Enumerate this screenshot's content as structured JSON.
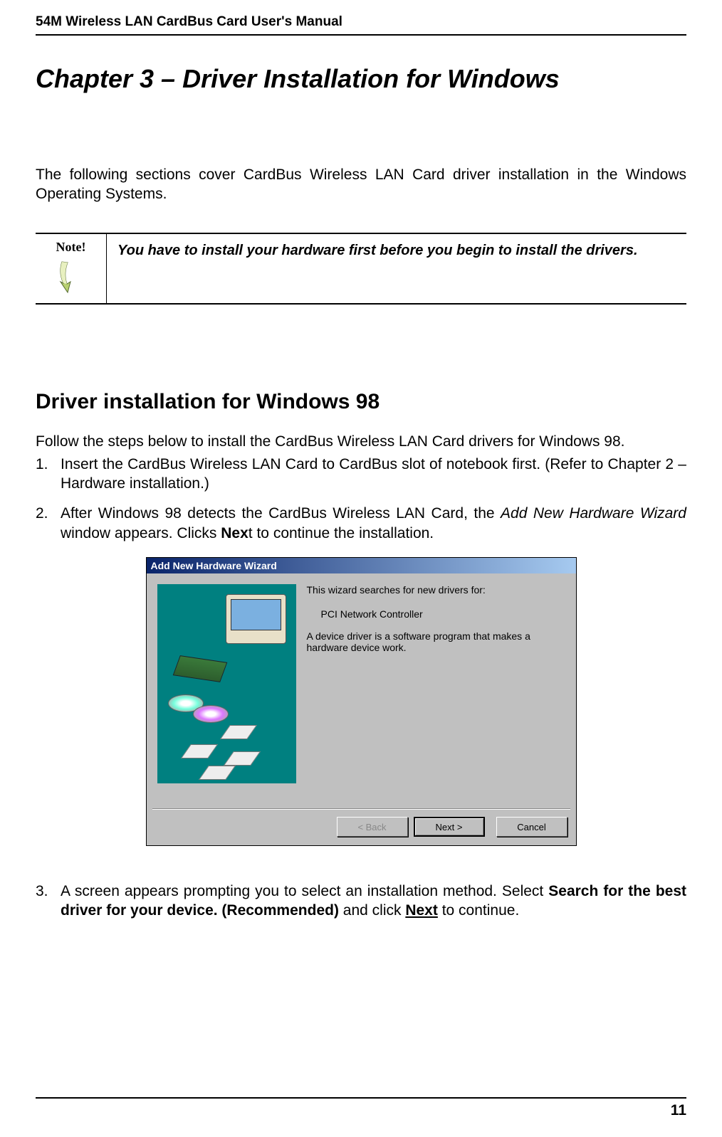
{
  "header": {
    "title": "54M Wireless LAN CardBus Card User's Manual"
  },
  "chapter": {
    "title": "Chapter 3 – Driver Installation for Windows"
  },
  "intro": "The following sections cover CardBus Wireless LAN Card driver installation in the Windows Operating Systems.",
  "note": {
    "label": "Note!",
    "text": "You have to install your hardware first before you begin to install the drivers."
  },
  "section": {
    "title": "Driver installation for Windows 98",
    "intro": "Follow the steps below to install the CardBus Wireless LAN Card drivers for Windows 98."
  },
  "steps": {
    "s1_num": "1.",
    "s1": "Insert the CardBus Wireless LAN Card to CardBus slot of notebook first. (Refer to Chapter 2 – Hardware installation.)",
    "s2_num": "2.",
    "s2_a": "After Windows 98 detects the CardBus Wireless LAN Card, the ",
    "s2_i": "Add New Hardware Wizard",
    "s2_b": " window appears. Clicks ",
    "s2_bold": "Nex",
    "s2_c": "t to continue the installation.",
    "s3_num": "3.",
    "s3_a": "A screen appears prompting you to select an installation method. Select ",
    "s3_bold1": "Search for the best driver for your device. (Recommended)",
    "s3_b": " and click ",
    "s3_bold2": "Next",
    "s3_c": " to continue."
  },
  "wizard": {
    "title": "Add New Hardware Wizard",
    "line1": "This wizard searches for new drivers for:",
    "device": "PCI Network Controller",
    "line2": "A device driver is a software program that makes a hardware device work.",
    "back": "< Back",
    "next": "Next >",
    "cancel": "Cancel"
  },
  "footer": {
    "page": "11"
  }
}
